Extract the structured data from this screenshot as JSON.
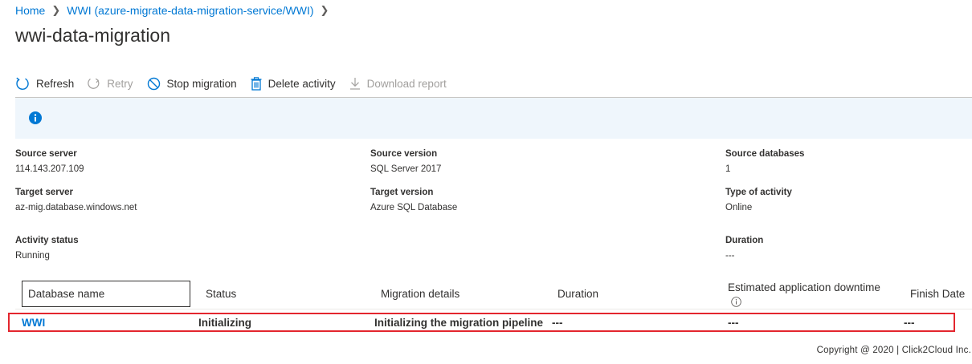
{
  "breadcrumb": {
    "home": "Home",
    "service": "WWI (azure-migrate-data-migration-service/WWI)"
  },
  "page_title": "wwi-data-migration",
  "toolbar": {
    "refresh": "Refresh",
    "retry": "Retry",
    "stop_migration": "Stop migration",
    "delete_activity": "Delete activity",
    "download_report": "Download report"
  },
  "details": {
    "source_server": {
      "label": "Source server",
      "value": "114.143.207.109"
    },
    "source_version": {
      "label": "Source version",
      "value": "SQL Server 2017"
    },
    "source_databases": {
      "label": "Source databases",
      "value": "1"
    },
    "target_server": {
      "label": "Target server",
      "value": "az-mig.database.windows.net"
    },
    "target_version": {
      "label": "Target version",
      "value": "Azure SQL Database"
    },
    "type_of_activity": {
      "label": "Type of activity",
      "value": "Online"
    },
    "activity_status": {
      "label": "Activity status",
      "value": "Running"
    },
    "duration": {
      "label": "Duration",
      "value": "---"
    }
  },
  "table": {
    "headers": {
      "database_name": "Database name",
      "status": "Status",
      "migration_details": "Migration details",
      "duration": "Duration",
      "estimated_downtime": "Estimated application downtime",
      "finish_date": "Finish Date"
    },
    "rows": [
      {
        "database_name": "WWI",
        "status": "Initializing",
        "migration_details": "Initializing the migration pipeline",
        "duration": "---",
        "estimated_downtime": "---",
        "finish_date": "---"
      }
    ]
  },
  "footer": "Copyright @ 2020 |   Click2Cloud Inc.",
  "colors": {
    "accent": "#0078d4",
    "banner_bg": "#eff6fc",
    "info_icon": "#0078d4",
    "highlight_border": "#e3262e"
  }
}
